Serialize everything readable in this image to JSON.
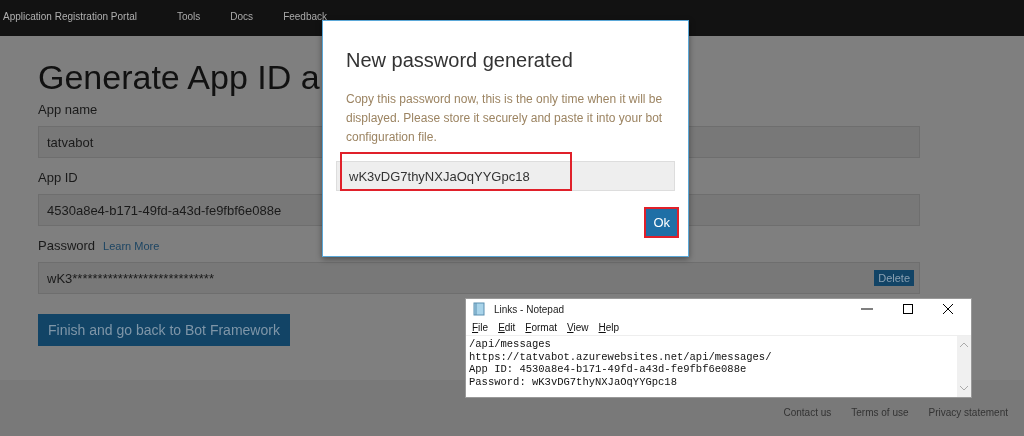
{
  "nav": {
    "brand": "Application Registration Portal",
    "links": [
      "Tools",
      "Docs",
      "Feedback"
    ]
  },
  "page": {
    "heading": "Generate App ID a",
    "fields": [
      {
        "label": "App name",
        "value": "tatvabot"
      },
      {
        "label": "App ID",
        "value": "4530a8e4-b171-49fd-a43d-fe9fbf6e088e"
      },
      {
        "label": "Password",
        "link": "Learn More",
        "value": "wK3****************************",
        "action": "Delete"
      }
    ],
    "button": "Finish and go back to Bot Framework"
  },
  "footer": {
    "links": [
      "Contact us",
      "Terms of use",
      "Privacy statement"
    ]
  },
  "dialog": {
    "title": "New password generated",
    "message": "Copy this password now, this is the only time when it will be displayed. Please store it securely and paste it into your bot configuration file.",
    "password": "wK3vDG7thyNXJaOqYYGpc18",
    "button": "Ok"
  },
  "notepad": {
    "title": "Links - Notepad",
    "menu": [
      "File",
      "Edit",
      "Format",
      "View",
      "Help"
    ],
    "lines": [
      "/api/messages",
      "https://tatvabot.azurewebsites.net/api/messages/",
      "App ID: 4530a8e4-b171-49fd-a43d-fe9fbf6e088e",
      "Password: wK3vDG7thyNXJaOqYYGpc18"
    ]
  }
}
